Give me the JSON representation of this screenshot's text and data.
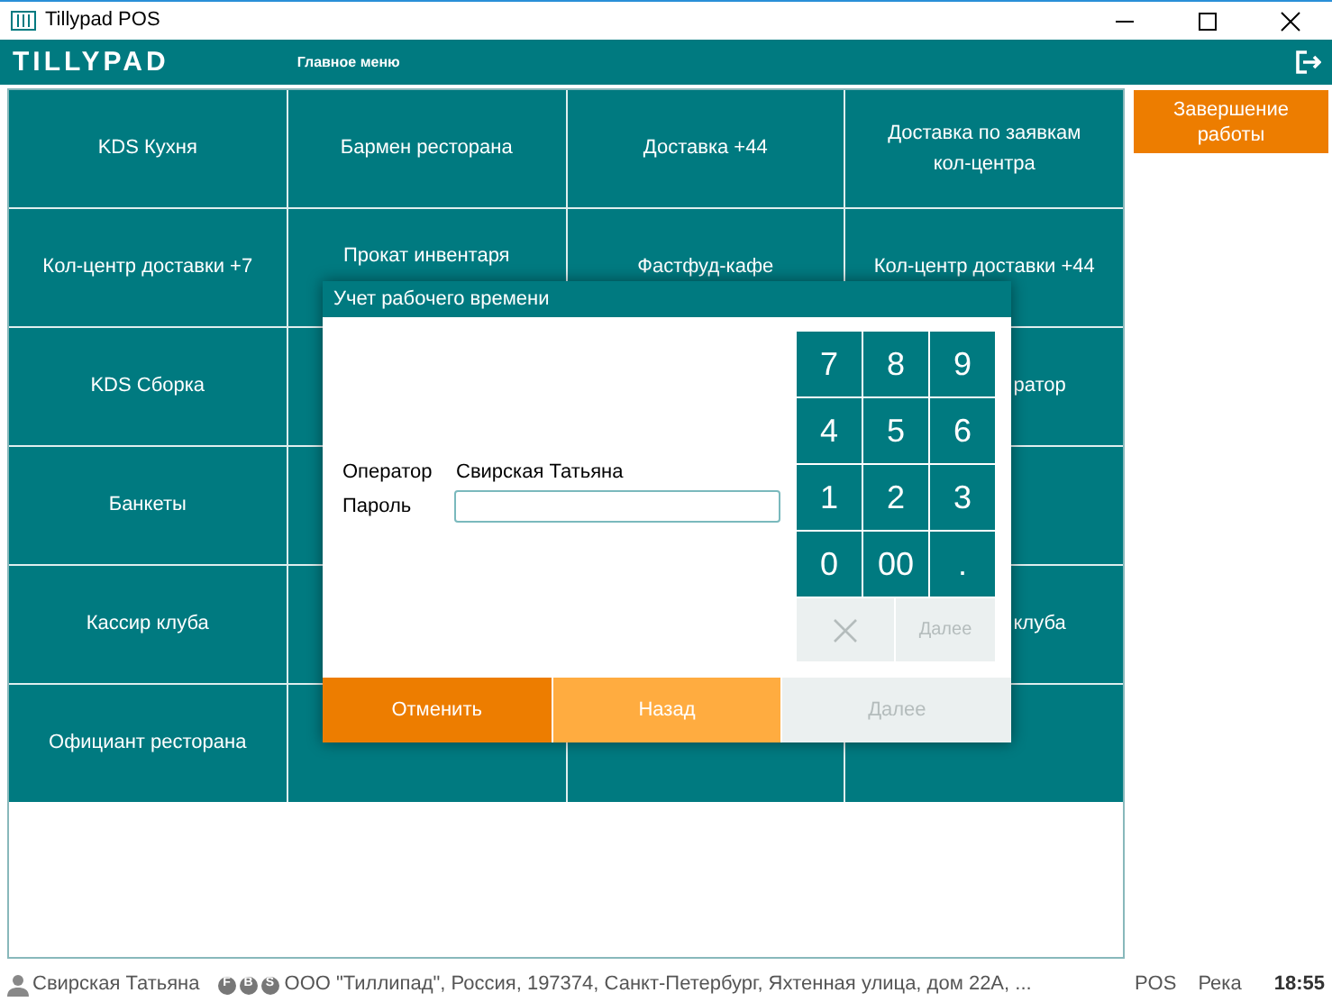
{
  "window": {
    "title": "Tillypad POS"
  },
  "header": {
    "logo": "TILLYPAD",
    "menu_title": "Главное меню"
  },
  "tiles": [
    {
      "kind": "full",
      "lines": [
        "KDS Кухня"
      ]
    },
    {
      "kind": "full",
      "lines": [
        "Бармен ресторана"
      ]
    },
    {
      "kind": "full",
      "lines": [
        "Доставка +44"
      ]
    },
    {
      "kind": "full",
      "lines": [
        "Доставка по заявкам",
        "кол-центра"
      ]
    },
    {
      "kind": "full",
      "lines": [
        "Кол-центр доставки +7"
      ]
    },
    {
      "kind": "top",
      "lines": [
        "Прокат инвентаря"
      ]
    },
    {
      "kind": "full",
      "lines": [
        "Фастфуд-кафе"
      ]
    },
    {
      "kind": "full",
      "lines": [
        "Кол-центр доставки +44"
      ]
    },
    {
      "kind": "full",
      "lines": [
        "KDS Сборка"
      ]
    },
    {
      "kind": "empty"
    },
    {
      "kind": "right",
      "lines": [
        "ратор"
      ]
    },
    {
      "kind": "full",
      "lines": [
        "Банкеты"
      ]
    },
    {
      "kind": "empty"
    },
    {
      "kind": "edge"
    },
    {
      "kind": "full",
      "lines": [
        "Кассир клуба"
      ]
    },
    {
      "kind": "empty"
    },
    {
      "kind": "right",
      "lines": [
        "клуба"
      ]
    },
    {
      "kind": "full",
      "lines": [
        "Официант ресторана"
      ]
    },
    {
      "kind": "empty"
    },
    {
      "kind": "empty"
    },
    {
      "kind": "empty"
    }
  ],
  "side_button": "Завершение работы",
  "dialog": {
    "title": "Учет рабочего времени",
    "operator_label": "Оператор",
    "operator_value": "Свирская Татьяна",
    "password_label": "Пароль",
    "keys": [
      "7",
      "8",
      "9",
      "4",
      "5",
      "6",
      "1",
      "2",
      "3",
      "0",
      "00",
      "."
    ],
    "keypad_next": {
      "label": "Далее",
      "disabled": true
    },
    "buttons": [
      {
        "label": "Отменить",
        "kind": "cancel",
        "disabled": false
      },
      {
        "label": "Назад",
        "kind": "back",
        "disabled": false
      },
      {
        "label": "Далее",
        "kind": "next",
        "disabled": true
      }
    ]
  },
  "status_bar": {
    "user": "Свирская Татьяна",
    "badges": [
      "F",
      "B",
      "S"
    ],
    "company": "ООО \"Тиллипад\", Россия, 197374, Санкт-Петербург, Яхтенная улица, дом 22А, ...",
    "mode": "POS",
    "location": "Река",
    "time": "18:55"
  }
}
